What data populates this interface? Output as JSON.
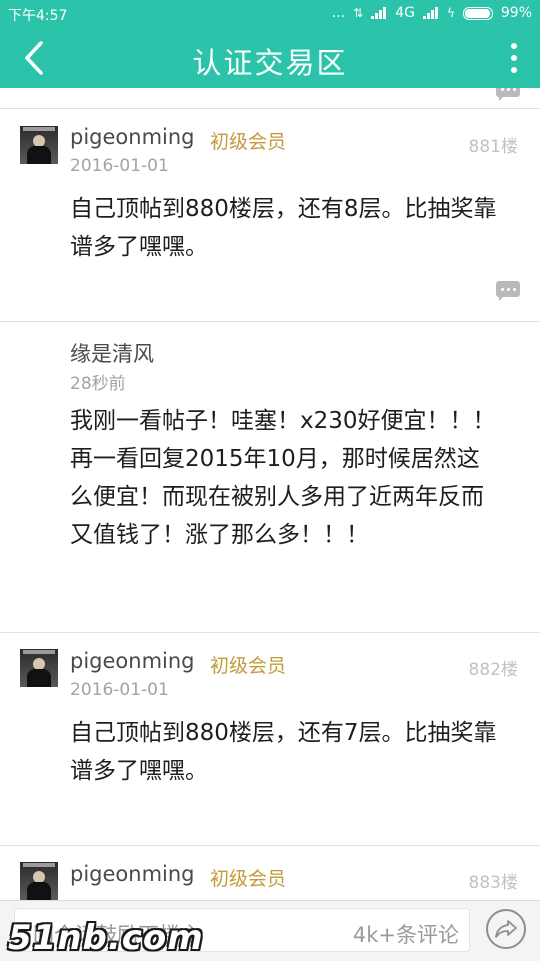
{
  "status_bar": {
    "time": "下午4:57",
    "dots": "...",
    "network": "4G",
    "battery": "99%"
  },
  "header": {
    "title": "认证交易区"
  },
  "posts": [
    {
      "user": "pigeonming",
      "badge": "初级会员",
      "floor": "881楼",
      "date": "2016-01-01",
      "text": "自己顶帖到880楼层，还有8层。比抽奖靠谱多了嘿嘿。"
    },
    {
      "user": "缘是清风",
      "date": "28秒前",
      "text": "我刚一看帖子！哇塞！x230好便宜！！！再一看回复2015年10月，那时候居然这么便宜！而现在被别人多用了近两年反而又值钱了！涨了那么多！！！"
    },
    {
      "user": "pigeonming",
      "badge": "初级会员",
      "floor": "882楼",
      "date": "2016-01-01",
      "text": "自己顶帖到880楼层，还有7层。比抽奖靠谱多了嘿嘿。"
    },
    {
      "user": "pigeonming",
      "badge": "初级会员",
      "floor": "883楼"
    }
  ],
  "bottom_bar": {
    "input_placeholder": "回个话鼓励下楼主",
    "comment_count": "4k+条评论"
  },
  "watermark": "51nb.com",
  "colors": {
    "header_bg": "#2bc4ab",
    "badge": "#c39a3c"
  }
}
